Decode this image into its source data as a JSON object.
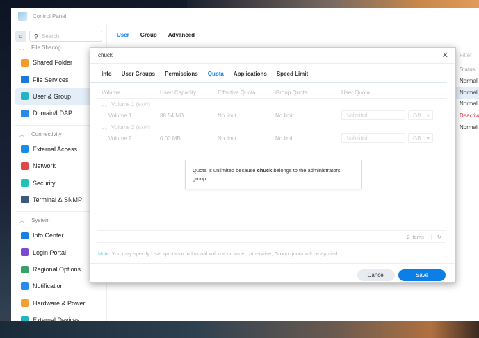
{
  "window": {
    "title": "Control Panel"
  },
  "sidebar": {
    "search_placeholder": "Search",
    "sections": [
      {
        "label": "File Sharing",
        "items": [
          {
            "label": "Shared Folder",
            "color": "#f39a2a"
          },
          {
            "label": "File Services",
            "color": "#1a78e0"
          },
          {
            "label": "User & Group",
            "color": "#1fb6c2",
            "active": true
          },
          {
            "label": "Domain/LDAP",
            "color": "#2a8be8"
          }
        ]
      },
      {
        "label": "Connectivity",
        "items": [
          {
            "label": "External Access",
            "color": "#1a8be8"
          },
          {
            "label": "Network",
            "color": "#e04848"
          },
          {
            "label": "Security",
            "color": "#1ec4b4"
          },
          {
            "label": "Terminal & SNMP",
            "color": "#3a5a80"
          }
        ]
      },
      {
        "label": "System",
        "items": [
          {
            "label": "Info Center",
            "color": "#1a7fe0"
          },
          {
            "label": "Login Portal",
            "color": "#7a4ad0"
          },
          {
            "label": "Regional Options",
            "color": "#3aa06a"
          },
          {
            "label": "Notification",
            "color": "#2a8be8"
          },
          {
            "label": "Hardware & Power",
            "color": "#f2a030"
          },
          {
            "label": "External Devices",
            "color": "#1fb6c2"
          }
        ]
      }
    ]
  },
  "main": {
    "tabs": [
      "User",
      "Group",
      "Advanced"
    ],
    "filter_placeholder": "Filter",
    "status_header": "Status",
    "statuses": [
      "Normal",
      "Normal",
      "Normal",
      "Deactivated",
      "Normal"
    ]
  },
  "dialog": {
    "title": "chuck",
    "tabs": [
      "Info",
      "User Groups",
      "Permissions",
      "Quota",
      "Applications",
      "Speed Limit"
    ],
    "columns": [
      "Volume",
      "Used Capacity",
      "Effective Quota",
      "Group Quota",
      "User Quota"
    ],
    "groups": [
      {
        "label": "Volume 1 (ext4)",
        "row": {
          "volume": "Volume 1",
          "used": "88.54 MB",
          "effective": "No limit",
          "group": "No limit",
          "user_placeholder": "Unlimited",
          "unit": "GB"
        }
      },
      {
        "label": "Volume 2 (ext4)",
        "row": {
          "volume": "Volume 2",
          "used": "0.00 MB",
          "effective": "No limit",
          "group": "No limit",
          "user_placeholder": "Unlimited",
          "unit": "GB"
        }
      }
    ],
    "message": {
      "pre": "Quota is unlimited because ",
      "user": "chuck",
      "post": " belongs to the administrators group."
    },
    "items_count": "2 items",
    "note_label": "Note:",
    "note_text": " You may specify User quota for individual volume or folder; otherwise, Group quota will be applied.",
    "cancel": "Cancel",
    "save": "Save"
  }
}
